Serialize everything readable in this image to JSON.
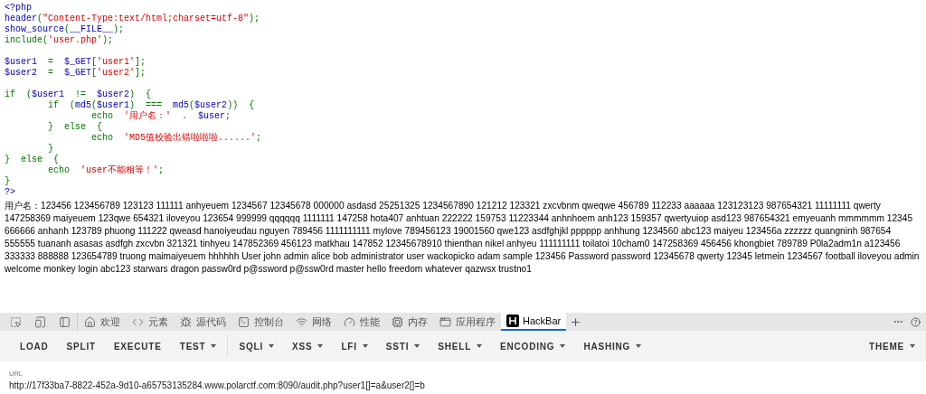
{
  "source_code": [
    [
      [
        {
          "kind": "default",
          "text": "<?php"
        }
      ],
      [
        {
          "kind": "default",
          "text": "header"
        },
        {
          "kind": "keyword",
          "text": "("
        },
        {
          "kind": "string",
          "text": "\"Content-Type:text/html;charset=utf-8\""
        },
        {
          "kind": "keyword",
          "text": ");"
        }
      ],
      [
        {
          "kind": "default",
          "text": "show_source"
        },
        {
          "kind": "keyword",
          "text": "("
        },
        {
          "kind": "default",
          "text": "__FILE__"
        },
        {
          "kind": "keyword",
          "text": ");"
        }
      ],
      [
        {
          "kind": "keyword",
          "text": "include("
        },
        {
          "kind": "string",
          "text": "'user.php'"
        },
        {
          "kind": "keyword",
          "text": ");"
        }
      ]
    ],
    [
      [
        {
          "kind": "default",
          "text": "$user1 "
        },
        {
          "kind": "keyword",
          "text": " = "
        },
        {
          "kind": "default",
          "text": " $_GET"
        },
        {
          "kind": "keyword",
          "text": "["
        },
        {
          "kind": "string",
          "text": "'user1'"
        },
        {
          "kind": "keyword",
          "text": "];"
        }
      ],
      [
        {
          "kind": "default",
          "text": "$user2 "
        },
        {
          "kind": "keyword",
          "text": " = "
        },
        {
          "kind": "default",
          "text": " $_GET"
        },
        {
          "kind": "keyword",
          "text": "["
        },
        {
          "kind": "string",
          "text": "'user2'"
        },
        {
          "kind": "keyword",
          "text": "];"
        }
      ]
    ],
    [
      [
        {
          "kind": "keyword",
          "text": "if  ("
        },
        {
          "kind": "default",
          "text": "$user1 "
        },
        {
          "kind": "keyword",
          "text": " !=  "
        },
        {
          "kind": "default",
          "text": "$user2"
        },
        {
          "kind": "keyword",
          "text": ")  {"
        }
      ],
      [
        {
          "kind": "keyword",
          "text": "        if  ("
        },
        {
          "kind": "default",
          "text": "md5"
        },
        {
          "kind": "keyword",
          "text": "("
        },
        {
          "kind": "default",
          "text": "$user1"
        },
        {
          "kind": "keyword",
          "text": ")  ===  "
        },
        {
          "kind": "default",
          "text": "md5"
        },
        {
          "kind": "keyword",
          "text": "("
        },
        {
          "kind": "default",
          "text": "$user2"
        },
        {
          "kind": "keyword",
          "text": "))  {"
        }
      ],
      [
        {
          "kind": "keyword",
          "text": "                echo  "
        },
        {
          "kind": "string",
          "text": "'用户名：'"
        },
        {
          "kind": "keyword",
          "text": "  .  "
        },
        {
          "kind": "default",
          "text": "$user"
        },
        {
          "kind": "keyword",
          "text": ";"
        }
      ],
      [
        {
          "kind": "keyword",
          "text": "        }  else  {"
        }
      ],
      [
        {
          "kind": "keyword",
          "text": "                echo  "
        },
        {
          "kind": "string",
          "text": "'MD5值校验出错啦啦啦......'"
        },
        {
          "kind": "keyword",
          "text": ";"
        }
      ],
      [
        {
          "kind": "keyword",
          "text": "        }"
        }
      ],
      [
        {
          "kind": "keyword",
          "text": "}  else  {"
        }
      ],
      [
        {
          "kind": "keyword",
          "text": "        echo  "
        },
        {
          "kind": "string",
          "text": "'user不能相等！'"
        },
        {
          "kind": "keyword",
          "text": ";"
        }
      ],
      [
        {
          "kind": "keyword",
          "text": "}"
        }
      ],
      [
        {
          "kind": "default",
          "text": "?>"
        }
      ]
    ]
  ],
  "output": "用户名：123456 123456789 123123 111111 anhyeuem 1234567 12345678 000000 asdasd 25251325 1234567890 121212 123321 zxcvbnm qweqwe 456789 112233 aaaaaa 123123123 987654321 11111111 qwerty 147258369 maiyeuem 123qwe 654321 iloveyou 123654 999999 qqqqqq 1111111 147258 hota407 anhtuan 222222 159753 11223344 anhnhoem anh123 159357 qwertyuiop asd123 987654321 emyeuanh mmmmmm 12345 666666 anhanh 123789 phuong 111222 qweasd hanoiyeudau nguyen 789456 1111111111 mylove 789456123 19001560 qwe123 asdfghjkl pppppp anhhung 1234560 abc123 maiyeu 123456a zzzzzz quangninh 987654 555555 tuananh asasas asdfgh zxcvbn 321321 tinhyeu 147852369 456123 matkhau 147852 12345678910 thienthan nikel anhyeu 111111111 toilatoi 10cham0 147258369 456456 khongbiet 789789 P0la2adm1n a123456 333333 888888 123654789 truong maimaiyeuem hhhhhh User john admin alice bob administrator user wackopicko adam sample 123456 Password password 12345678 qwerty 12345 letmein 1234567 football iloveyou admin welcome monkey login abc123 starwars dragon passw0rd p@ssword p@ssw0rd master hello freedom whatever qazwsx trustno1",
  "devtools_tabs": [
    {
      "kind": "inspect",
      "selected": false
    },
    {
      "kind": "device",
      "selected": false
    },
    {
      "kind": "sidebar",
      "selected": false
    },
    {
      "kind": "home",
      "label": "欢迎",
      "selected": false
    },
    {
      "kind": "code",
      "label": "元素",
      "selected": false
    },
    {
      "kind": "bug",
      "label": "源代码",
      "selected": false
    },
    {
      "kind": "terminal",
      "label": "控制台",
      "selected": false
    },
    {
      "kind": "wifi",
      "label": "网络",
      "selected": false
    },
    {
      "kind": "gauge",
      "label": "性能",
      "selected": false
    },
    {
      "kind": "chip",
      "label": "内存",
      "selected": false
    },
    {
      "kind": "app",
      "label": "应用程序",
      "selected": false
    },
    {
      "kind": "hackbar",
      "label": "HackBar",
      "selected": true
    }
  ],
  "hackbar_menu": [
    {
      "label": "LOAD",
      "dropdown": false
    },
    {
      "label": "SPLIT",
      "dropdown": false
    },
    {
      "label": "EXECUTE",
      "dropdown": false
    },
    {
      "label": "TEST",
      "dropdown": true
    },
    {
      "label": "SQLI",
      "dropdown": true
    },
    {
      "label": "XSS",
      "dropdown": true
    },
    {
      "label": "LFI",
      "dropdown": true
    },
    {
      "label": "SSTI",
      "dropdown": true
    },
    {
      "label": "SHELL",
      "dropdown": true
    },
    {
      "label": "ENCODING",
      "dropdown": true
    },
    {
      "label": "HASHING",
      "dropdown": true
    }
  ],
  "theme_menu": {
    "label": "THEME",
    "dropdown": true
  },
  "url_field": {
    "label": "URL",
    "value": "http://17f33ba7-8822-452a-9d10-a65753135284.www.polarctf.com:8090/audit.php?user1[]=a&user2[]=b"
  }
}
